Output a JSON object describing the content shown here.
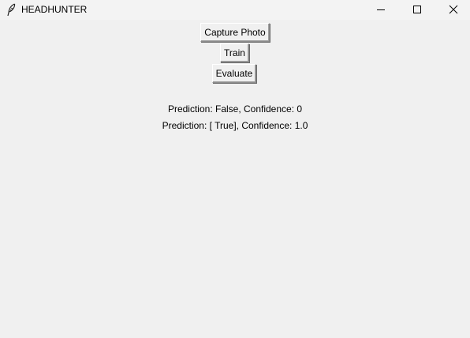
{
  "window": {
    "title": "HEADHUNTER",
    "controls": {
      "minimize_icon": "minimize-icon",
      "maximize_icon": "maximize-icon",
      "close_icon": "close-icon"
    }
  },
  "buttons": {
    "capture_label": "Capture Photo",
    "train_label": "Train",
    "evaluate_label": "Evaluate"
  },
  "results": {
    "line1": "Prediction: False, Confidence: 0",
    "line2": "Prediction: [ True], Confidence: 1.0"
  },
  "colors": {
    "background": "#f0f0f0",
    "titlebar": "#f3f3f3",
    "text": "#000000"
  }
}
